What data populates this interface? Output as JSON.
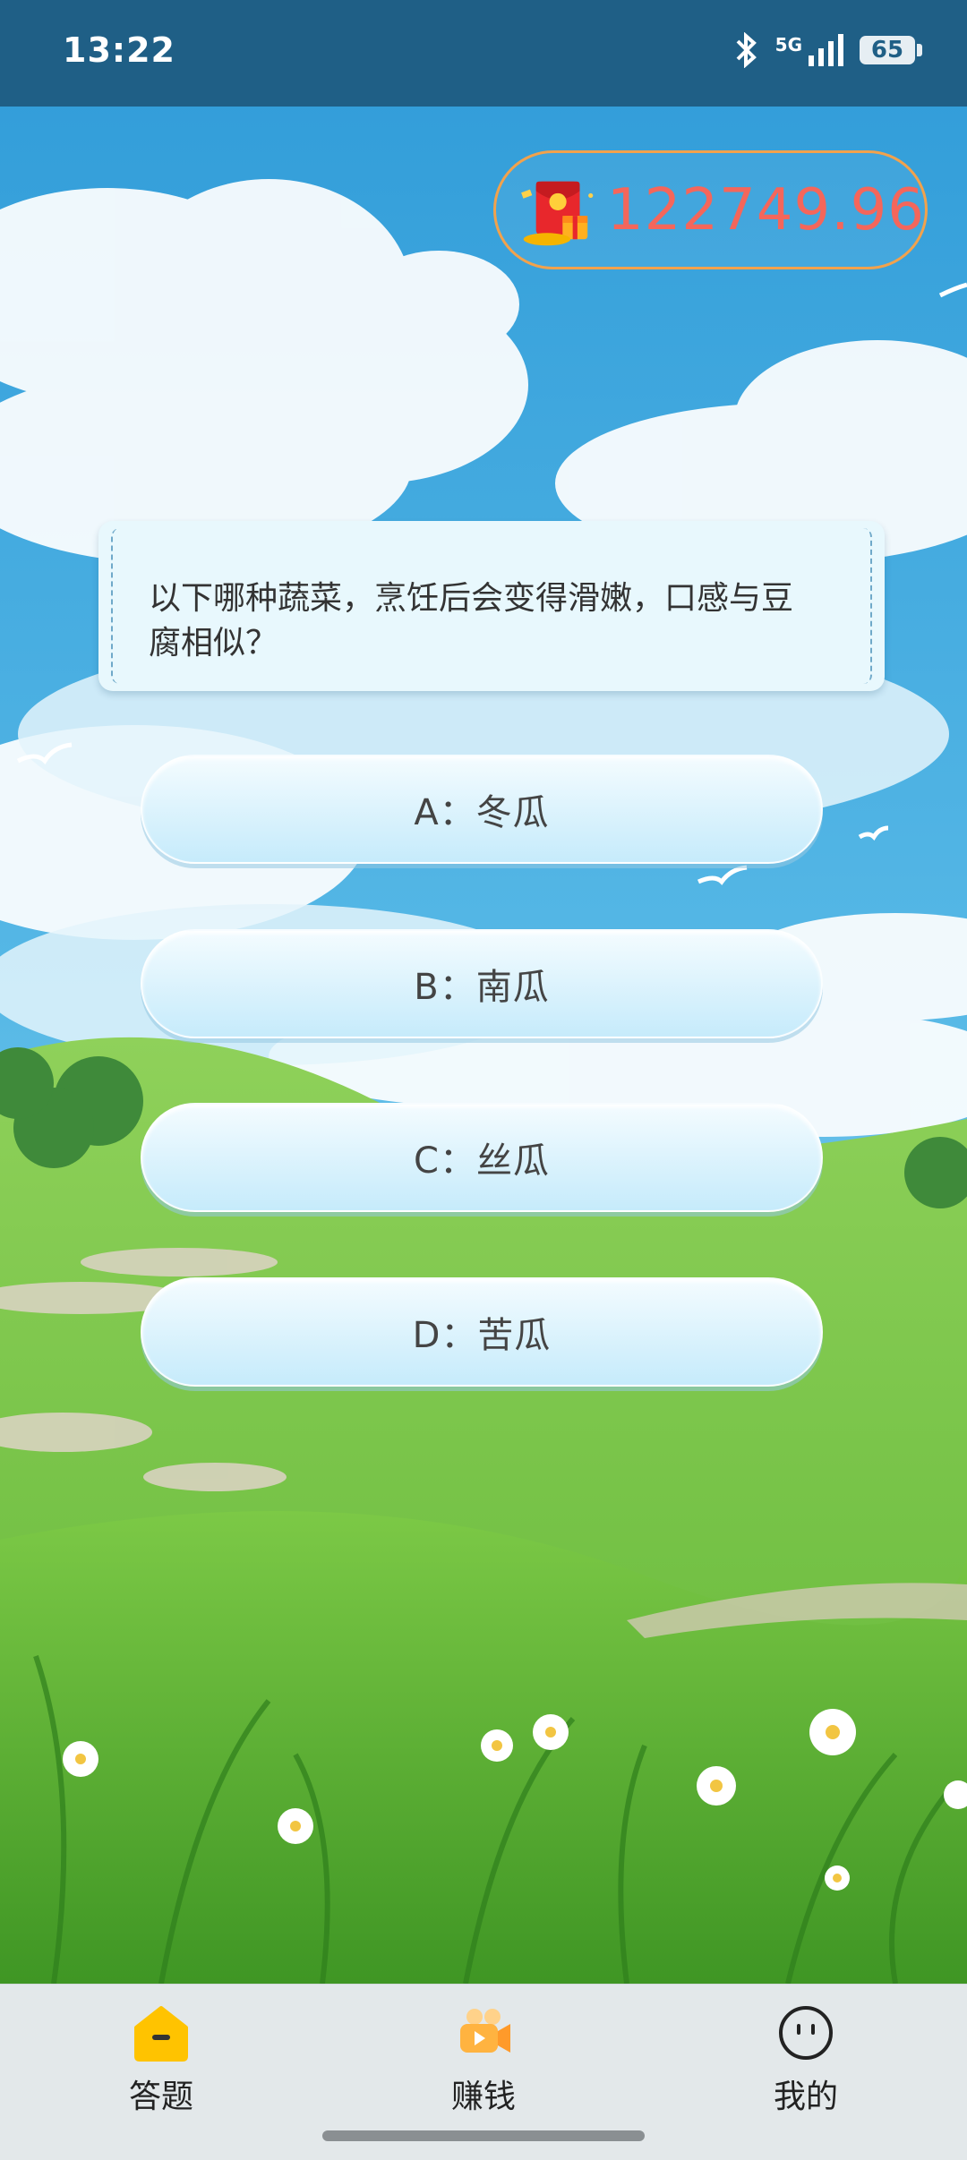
{
  "status_bar": {
    "time": "13:22",
    "network": "5G",
    "battery": "65",
    "icons": [
      "bluetooth-icon",
      "signal-5g-icon",
      "battery-icon"
    ]
  },
  "coins": {
    "value": "122749.96",
    "icon": "red-envelope-icon"
  },
  "question": {
    "text": "以下哪种蔬菜，烹饪后会变得滑嫩，口感与豆腐相似？"
  },
  "answers": [
    {
      "label": "A：冬瓜"
    },
    {
      "label": "B：南瓜"
    },
    {
      "label": "C：丝瓜"
    },
    {
      "label": "D：苦瓜"
    }
  ],
  "nav": {
    "items": [
      {
        "label": "答题",
        "icon": "house-icon",
        "active": true
      },
      {
        "label": "赚钱",
        "icon": "video-camera-icon",
        "active": false
      },
      {
        "label": "我的",
        "icon": "face-icon",
        "active": false
      }
    ]
  },
  "colors": {
    "status_bar": "#1f5f86",
    "sky": "#3ea7dc",
    "grass": "#6cc43a",
    "coin_text": "#f4665b",
    "coin_border": "#f2a24c",
    "nav_active": "#ffc300",
    "nav_bg": "#e3e8ea"
  }
}
